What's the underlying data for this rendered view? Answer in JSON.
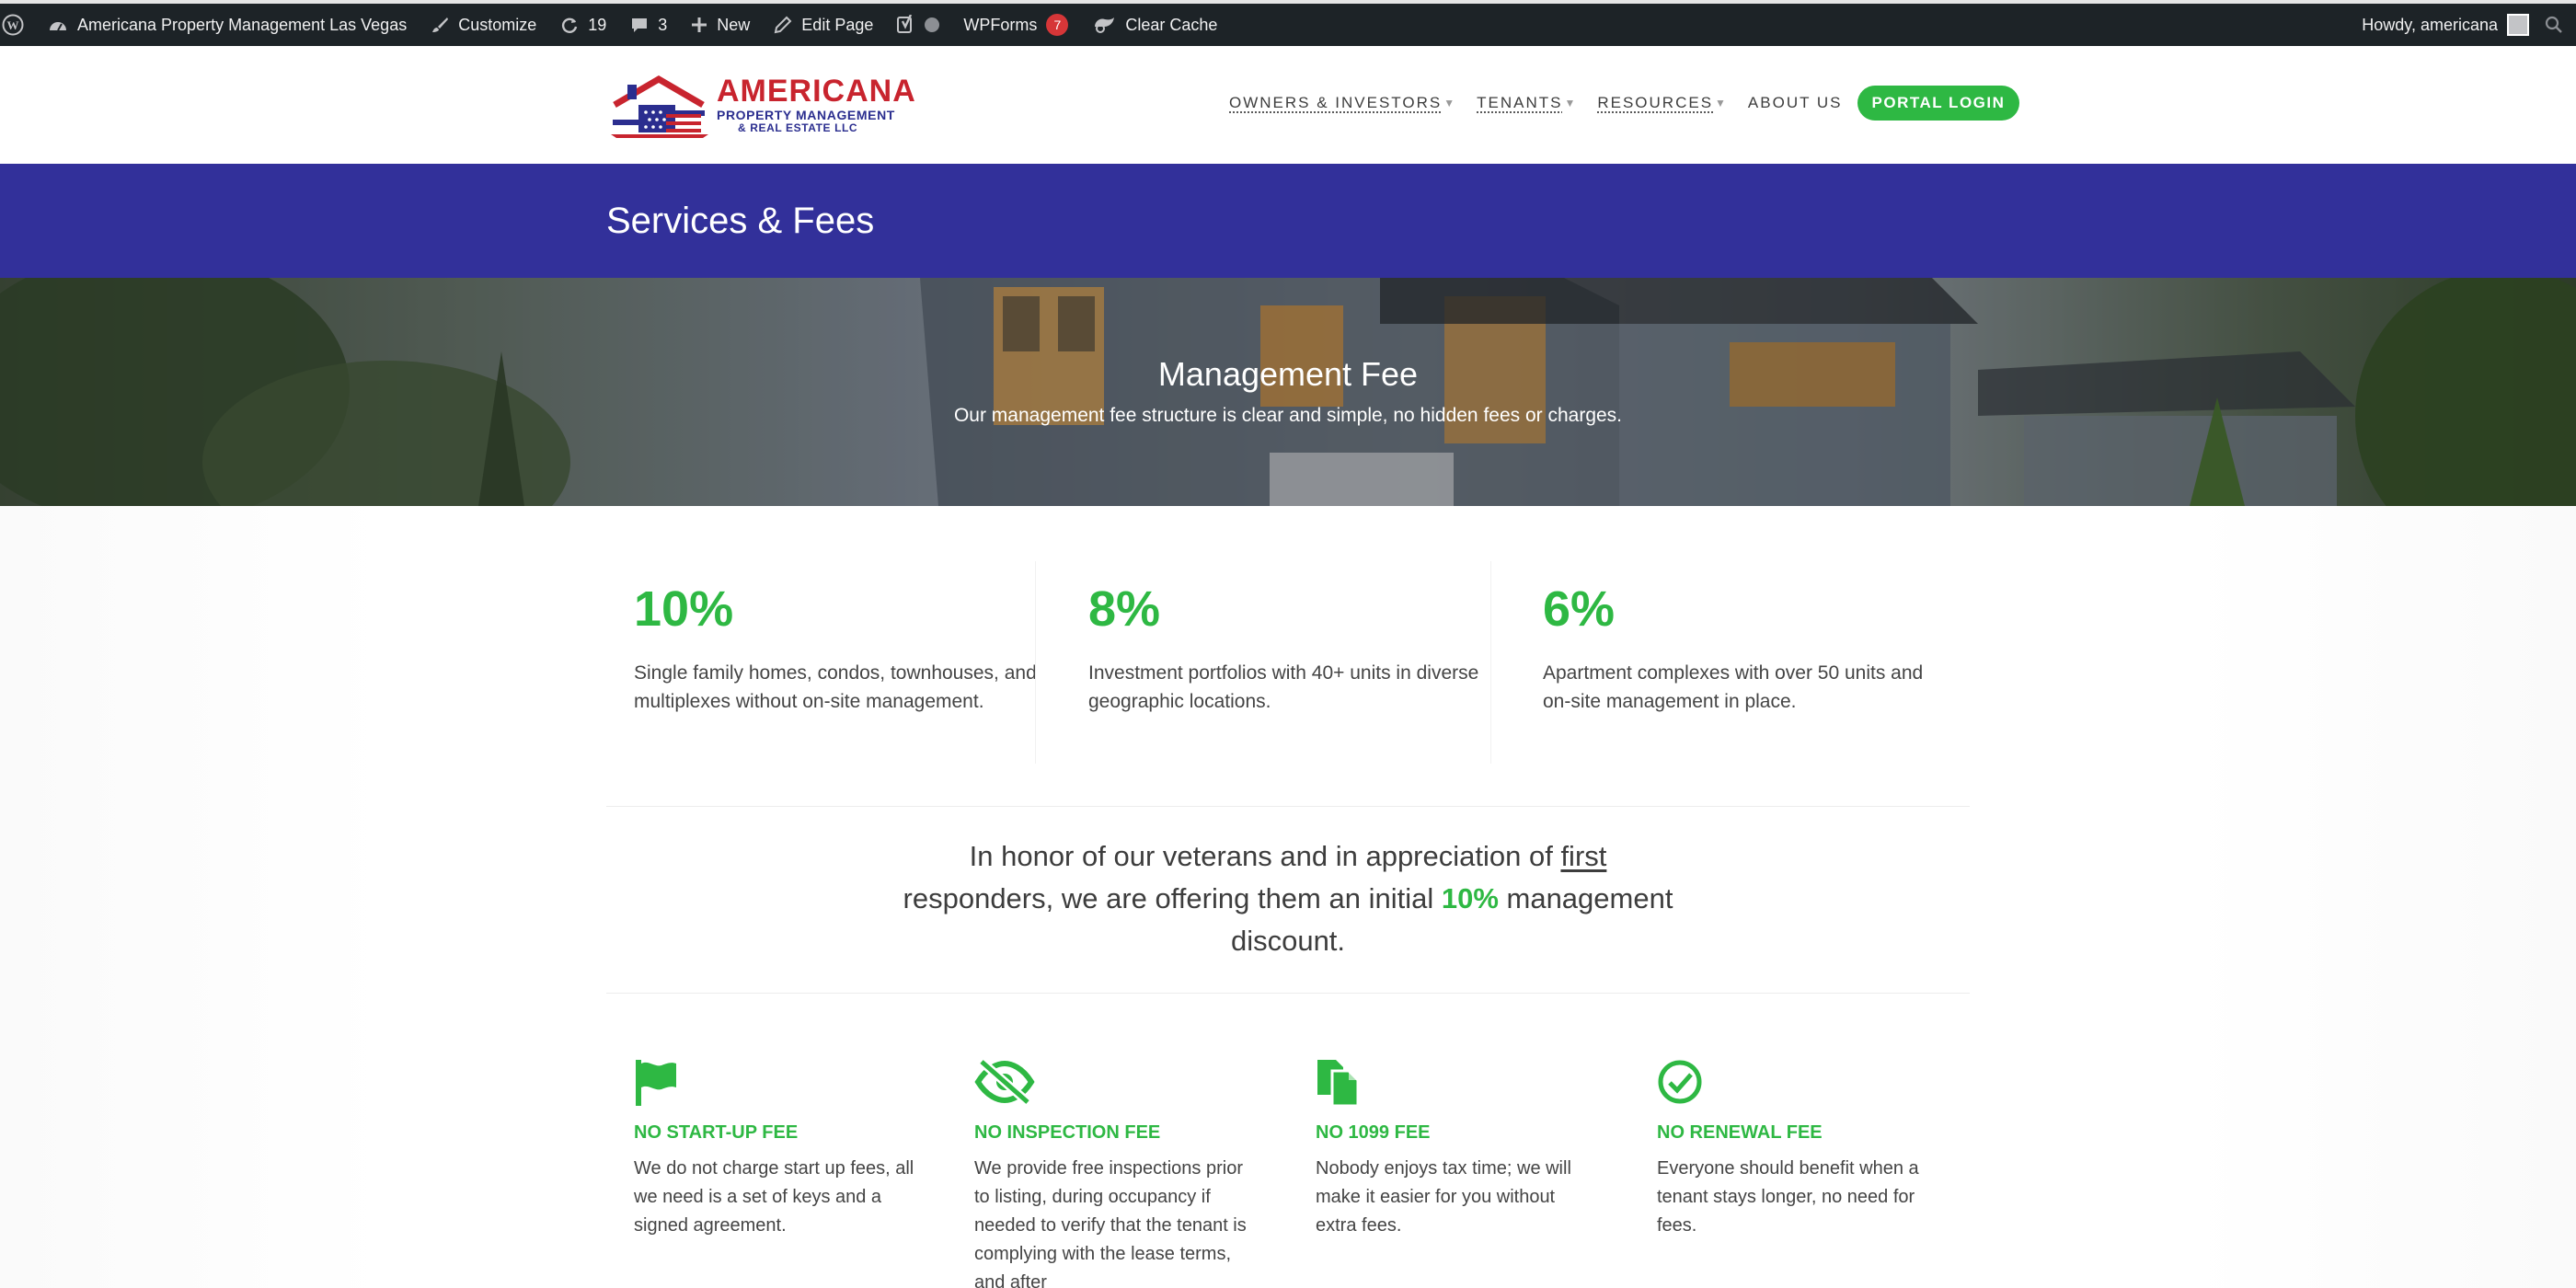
{
  "admin_bar": {
    "site_name": "Americana Property Management Las Vegas",
    "customize": "Customize",
    "updates_count": "19",
    "comments_count": "3",
    "new": "New",
    "edit_page": "Edit Page",
    "wpforms": "WPForms",
    "wpforms_badge": "7",
    "clear_cache": "Clear Cache",
    "howdy": "Howdy, americana"
  },
  "logo": {
    "main": "AMERICANA",
    "line1": "PROPERTY MANAGEMENT",
    "line2": "& REAL ESTATE LLC"
  },
  "nav": {
    "items": [
      {
        "label": "OWNERS & INVESTORS"
      },
      {
        "label": "TENANTS"
      },
      {
        "label": "RESOURCES"
      },
      {
        "label": "ABOUT US"
      }
    ],
    "portal_login": "PORTAL LOGIN"
  },
  "page_title": "Services & Fees",
  "hero": {
    "title": "Management Fee",
    "subtitle": "Our management fee structure is clear and simple, no hidden fees or charges."
  },
  "fees": [
    {
      "pct": "10%",
      "desc": "Single family homes, condos, townhouses, and multiplexes without on-site management."
    },
    {
      "pct": "8%",
      "desc": "Investment portfolios with 40+ units in diverse geographic locations."
    },
    {
      "pct": "6%",
      "desc": "Apartment complexes with over 50 units and on-site management in place."
    }
  ],
  "veteran": {
    "part1": "In honor of our veterans and in appreciation of ",
    "link": "first",
    "part2": " responders, we are offering them an initial ",
    "highlight": "10%",
    "part3": " management discount."
  },
  "no_fees": [
    {
      "icon": "flag-icon",
      "title": "NO START-UP FEE",
      "desc": "We do not charge start up fees, all we need is a set of keys and a signed agreement."
    },
    {
      "icon": "eye-slash-icon",
      "title": "NO INSPECTION FEE",
      "desc": "We provide free inspections prior to listing, during occupancy if needed to verify that the tenant is complying with the lease terms, and after"
    },
    {
      "icon": "documents-icon",
      "title": "NO 1099 FEE",
      "desc": "Nobody enjoys tax time; we will make it easier for you without extra fees."
    },
    {
      "icon": "check-circle-icon",
      "title": "NO RENEWAL FEE",
      "desc": "Everyone should benefit when a tenant stays longer, no need for fees."
    }
  ],
  "colors": {
    "admin_bar": "#1d2327",
    "brand_blue": "#32309a",
    "accent_green": "#2eb843",
    "logo_red": "#c8242e"
  }
}
